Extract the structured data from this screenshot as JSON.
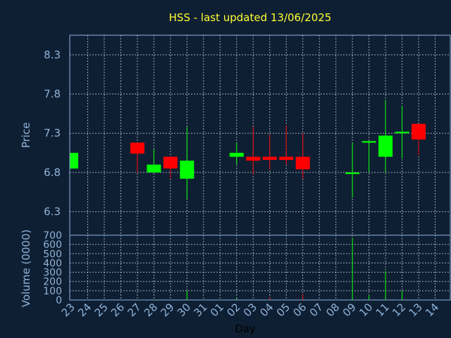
{
  "chart_data": {
    "type": "candlestick",
    "title": "HSS - last updated 13/06/2025",
    "xlabel": "Day",
    "ylabel": "Price",
    "volume_label": "Volume (0000)",
    "grid": true,
    "ylim": [
      6.0,
      8.55
    ],
    "volume_ylim": [
      0,
      700
    ],
    "price_ticks": [
      6.3,
      6.8,
      7.3,
      7.8,
      8.3
    ],
    "volume_ticks": [
      0,
      100,
      200,
      300,
      400,
      500,
      600,
      700
    ],
    "up_color": "#00ff00",
    "down_color": "#ff0000",
    "categories": [
      "23",
      "24",
      "25",
      "26",
      "27",
      "28",
      "29",
      "30",
      "31",
      "01",
      "02",
      "03",
      "04",
      "05",
      "06",
      "07",
      "08",
      "09",
      "10",
      "11",
      "12",
      "13",
      "14"
    ],
    "candles": [
      {
        "day": "23",
        "open": 6.85,
        "high": 7.05,
        "low": 6.85,
        "close": 7.05,
        "volume": 0
      },
      {
        "day": "27",
        "open": 7.18,
        "high": 7.18,
        "low": 6.8,
        "close": 7.04,
        "volume": 0
      },
      {
        "day": "28",
        "open": 6.8,
        "high": 7.1,
        "low": 6.8,
        "close": 6.9,
        "volume": 5
      },
      {
        "day": "29",
        "open": 7.0,
        "high": 7.0,
        "low": 6.72,
        "close": 6.85,
        "volume": 0
      },
      {
        "day": "30",
        "open": 6.72,
        "high": 7.38,
        "low": 6.46,
        "close": 6.95,
        "volume": 100
      },
      {
        "day": "02",
        "open": 7.0,
        "high": 7.18,
        "low": 6.9,
        "close": 7.05,
        "volume": 20
      },
      {
        "day": "03",
        "open": 7.0,
        "high": 7.38,
        "low": 6.78,
        "close": 6.95,
        "volume": 0
      },
      {
        "day": "04",
        "open": 7.0,
        "high": 7.28,
        "low": 6.84,
        "close": 6.96,
        "volume": 30
      },
      {
        "day": "05",
        "open": 7.0,
        "high": 7.4,
        "low": 6.9,
        "close": 6.96,
        "volume": 0
      },
      {
        "day": "06",
        "open": 7.0,
        "high": 7.3,
        "low": 6.72,
        "close": 6.84,
        "volume": 60
      },
      {
        "day": "09",
        "open": 6.78,
        "high": 7.18,
        "low": 6.48,
        "close": 6.8,
        "volume": 670
      },
      {
        "day": "10",
        "open": 7.18,
        "high": 7.2,
        "low": 6.8,
        "close": 7.2,
        "volume": 50
      },
      {
        "day": "11",
        "open": 7.0,
        "high": 7.72,
        "low": 6.8,
        "close": 7.27,
        "volume": 310
      },
      {
        "day": "12",
        "open": 7.3,
        "high": 7.65,
        "low": 6.98,
        "close": 7.32,
        "volume": 100
      },
      {
        "day": "13",
        "open": 7.42,
        "high": 7.42,
        "low": 7.02,
        "close": 7.22,
        "volume": 0
      }
    ]
  }
}
